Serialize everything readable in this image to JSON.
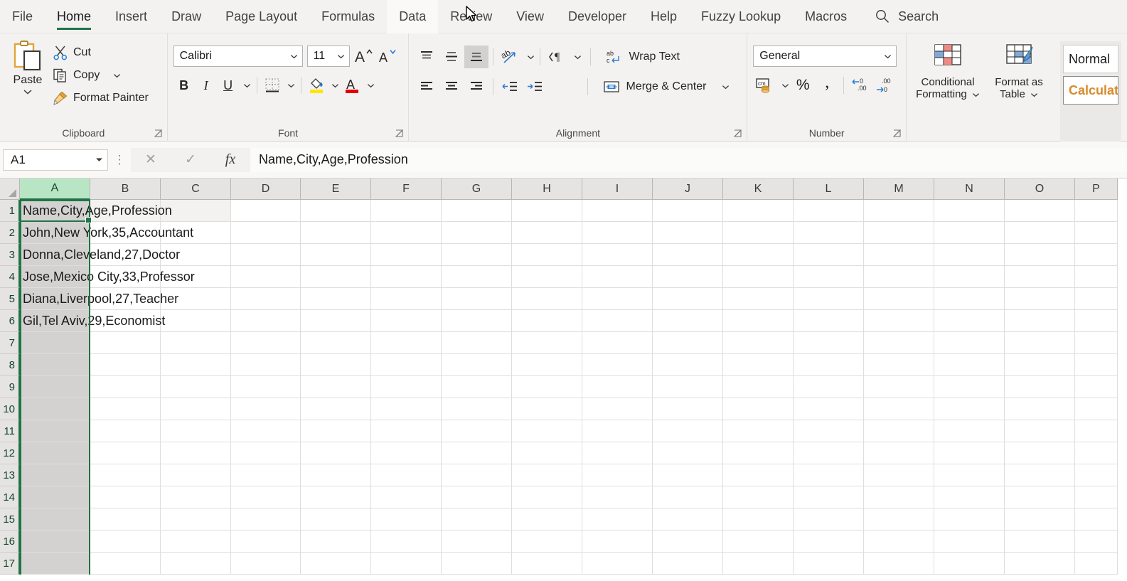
{
  "tabs": [
    {
      "label": "File",
      "state": "normal"
    },
    {
      "label": "Home",
      "state": "active"
    },
    {
      "label": "Insert",
      "state": "normal"
    },
    {
      "label": "Draw",
      "state": "normal"
    },
    {
      "label": "Page Layout",
      "state": "normal"
    },
    {
      "label": "Formulas",
      "state": "normal"
    },
    {
      "label": "Data",
      "state": "hovered"
    },
    {
      "label": "Review",
      "state": "normal"
    },
    {
      "label": "View",
      "state": "normal"
    },
    {
      "label": "Developer",
      "state": "normal"
    },
    {
      "label": "Help",
      "state": "normal"
    },
    {
      "label": "Fuzzy Lookup",
      "state": "normal"
    },
    {
      "label": "Macros",
      "state": "normal"
    }
  ],
  "search": {
    "label": "Search",
    "icon": "search-icon"
  },
  "ribbon": {
    "clipboard": {
      "group_label": "Clipboard",
      "paste_label": "Paste",
      "cut_label": "Cut",
      "copy_label": "Copy",
      "format_painter_label": "Format Painter"
    },
    "font": {
      "group_label": "Font",
      "font_name": "Calibri",
      "font_size": "11",
      "bold_label": "B",
      "italic_label": "I",
      "underline_label": "U",
      "grow_font_icon": "increase-font-size-icon",
      "shrink_font_icon": "decrease-font-size-icon",
      "borders_icon": "borders-icon",
      "fill_color_icon": "fill-color-icon",
      "font_color_icon": "font-color-icon",
      "fill_color": "#ffe600",
      "font_color": "#e00000"
    },
    "alignment": {
      "group_label": "Alignment",
      "wrap_text_label": "Wrap Text",
      "merge_center_label": "Merge & Center",
      "orientation_icon": "orientation-icon",
      "text_direction_icon": "text-direction-icon",
      "decrease_indent_icon": "decrease-indent-icon",
      "increase_indent_icon": "increase-indent-icon",
      "active_align": "bottom-align"
    },
    "number": {
      "group_label": "Number",
      "number_format": "General",
      "accounting_icon": "accounting-number-format-icon",
      "percent_label": "%",
      "comma_label": ",",
      "increase_decimal_icon": "increase-decimal-icon",
      "decrease_decimal_icon": "decrease-decimal-icon"
    },
    "styles": {
      "conditional_formatting_label": "Conditional\nFormatting",
      "conditional_formatting_line1": "Conditional",
      "conditional_formatting_line2": "Formatting",
      "format_as_table_line1": "Format as",
      "format_as_table_line2": "Table",
      "style_normal": "Normal",
      "style_calculation": "Calculation"
    }
  },
  "formula_bar": {
    "name_box": "A1",
    "cancel_icon": "cancel-icon",
    "confirm_icon": "confirm-icon",
    "function_icon": "insert-function-icon",
    "formula_value": "Name,City,Age,Profession"
  },
  "grid": {
    "columns": [
      "A",
      "B",
      "C",
      "D",
      "E",
      "F",
      "G",
      "H",
      "I",
      "J",
      "K",
      "L",
      "M",
      "N",
      "O",
      "P"
    ],
    "selected_column": "A",
    "rows": [
      "1",
      "2",
      "3",
      "4",
      "5",
      "6",
      "7",
      "8",
      "9",
      "10",
      "11",
      "12",
      "13",
      "14",
      "15",
      "16",
      "17"
    ],
    "cells_column_a": [
      "Name,City,Age,Profession",
      "John,New York,35,Accountant",
      "Donna,Cleveland,27,Doctor",
      "Jose,Mexico City,33,Professor",
      "Diana,Liverpool,27,Teacher",
      "Gil,Tel Aviv,29,Economist"
    ],
    "active_cell": "A1"
  },
  "colors": {
    "accent_green": "#217346",
    "ribbon_bg": "#f3f2f1",
    "header_bg": "#e6e4e2",
    "selected_header": "#b8e6c4"
  }
}
